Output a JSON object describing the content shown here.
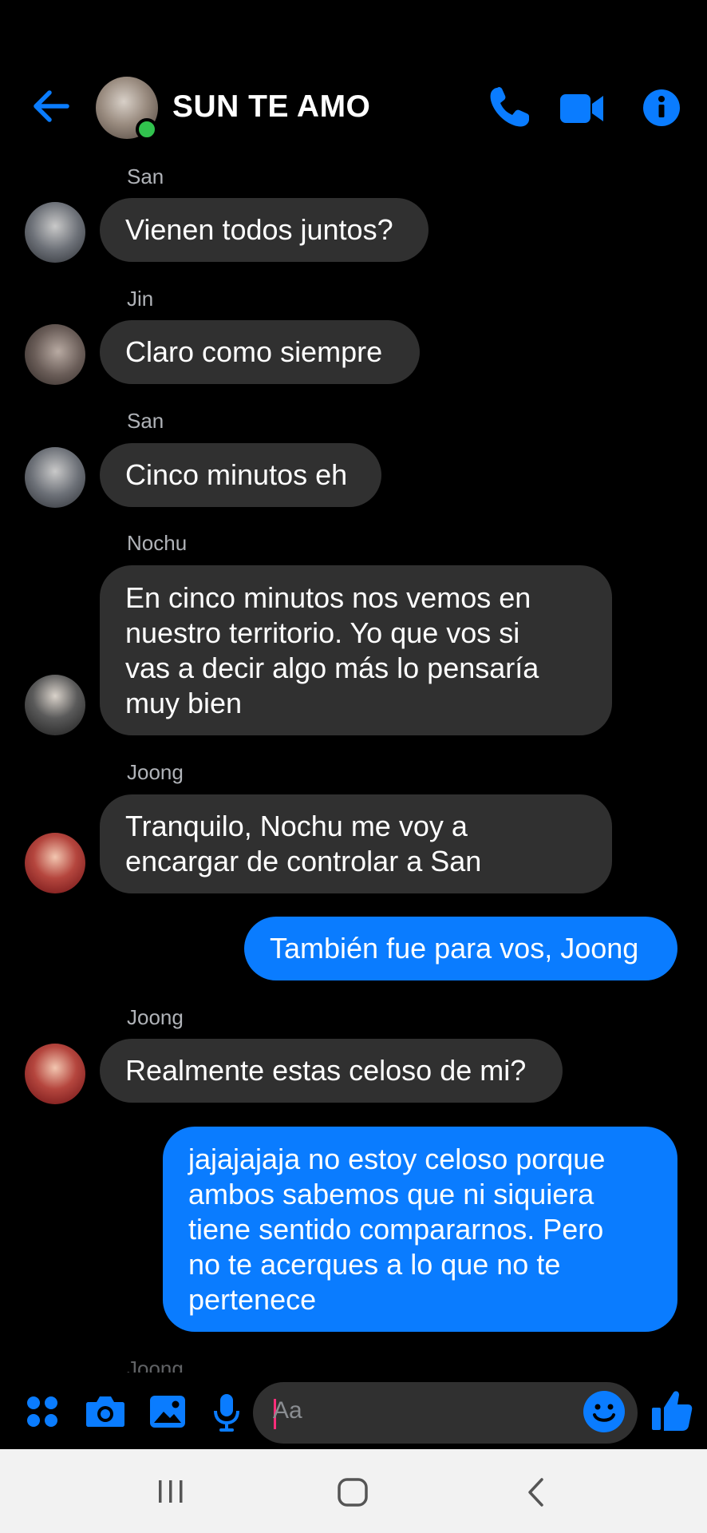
{
  "header": {
    "title": "SUN TE AMO",
    "back_icon": "arrow-left-icon",
    "icons": [
      "phone-icon",
      "video-camera-icon",
      "info-icon"
    ],
    "accent_color": "#0a7cff",
    "online_color": "#31c24e"
  },
  "messages": [
    {
      "sender": "San",
      "text": "Vienen todos juntos?"
    },
    {
      "sender": "Jin",
      "text": "Claro como siempre"
    },
    {
      "sender": "San",
      "text": "Cinco minutos eh"
    },
    {
      "sender": "Nochu",
      "lines": [
        "En cinco minutos nos vemos en",
        "nuestro territorio. Yo que vos si",
        "vas a decir algo más lo pensaría",
        "muy bien"
      ]
    },
    {
      "sender": "Joong",
      "lines": [
        "Tranquilo, Nochu me voy a",
        "encargar de controlar a San"
      ]
    },
    {
      "sender": "me",
      "text": "También fue para vos, Joong"
    },
    {
      "sender": "Joong",
      "text": "Realmente estas celoso de mi?"
    },
    {
      "sender": "me",
      "lines": [
        "jajajajaja no estoy celoso porque",
        "ambos sabemos que ni siquiera",
        "tiene sentido compararnos. Pero",
        "no te acerques a lo que no te",
        "pertenece"
      ]
    },
    {
      "sender": "Joong"
    }
  ],
  "composer": {
    "placeholder": "Aa",
    "icons": [
      "apps-grid-icon",
      "camera-icon",
      "gallery-icon",
      "microphone-icon",
      "emoji-icon",
      "thumbs-up-icon"
    ]
  },
  "system_nav": {
    "icons": [
      "recent-apps-icon",
      "home-icon",
      "back-icon"
    ]
  }
}
